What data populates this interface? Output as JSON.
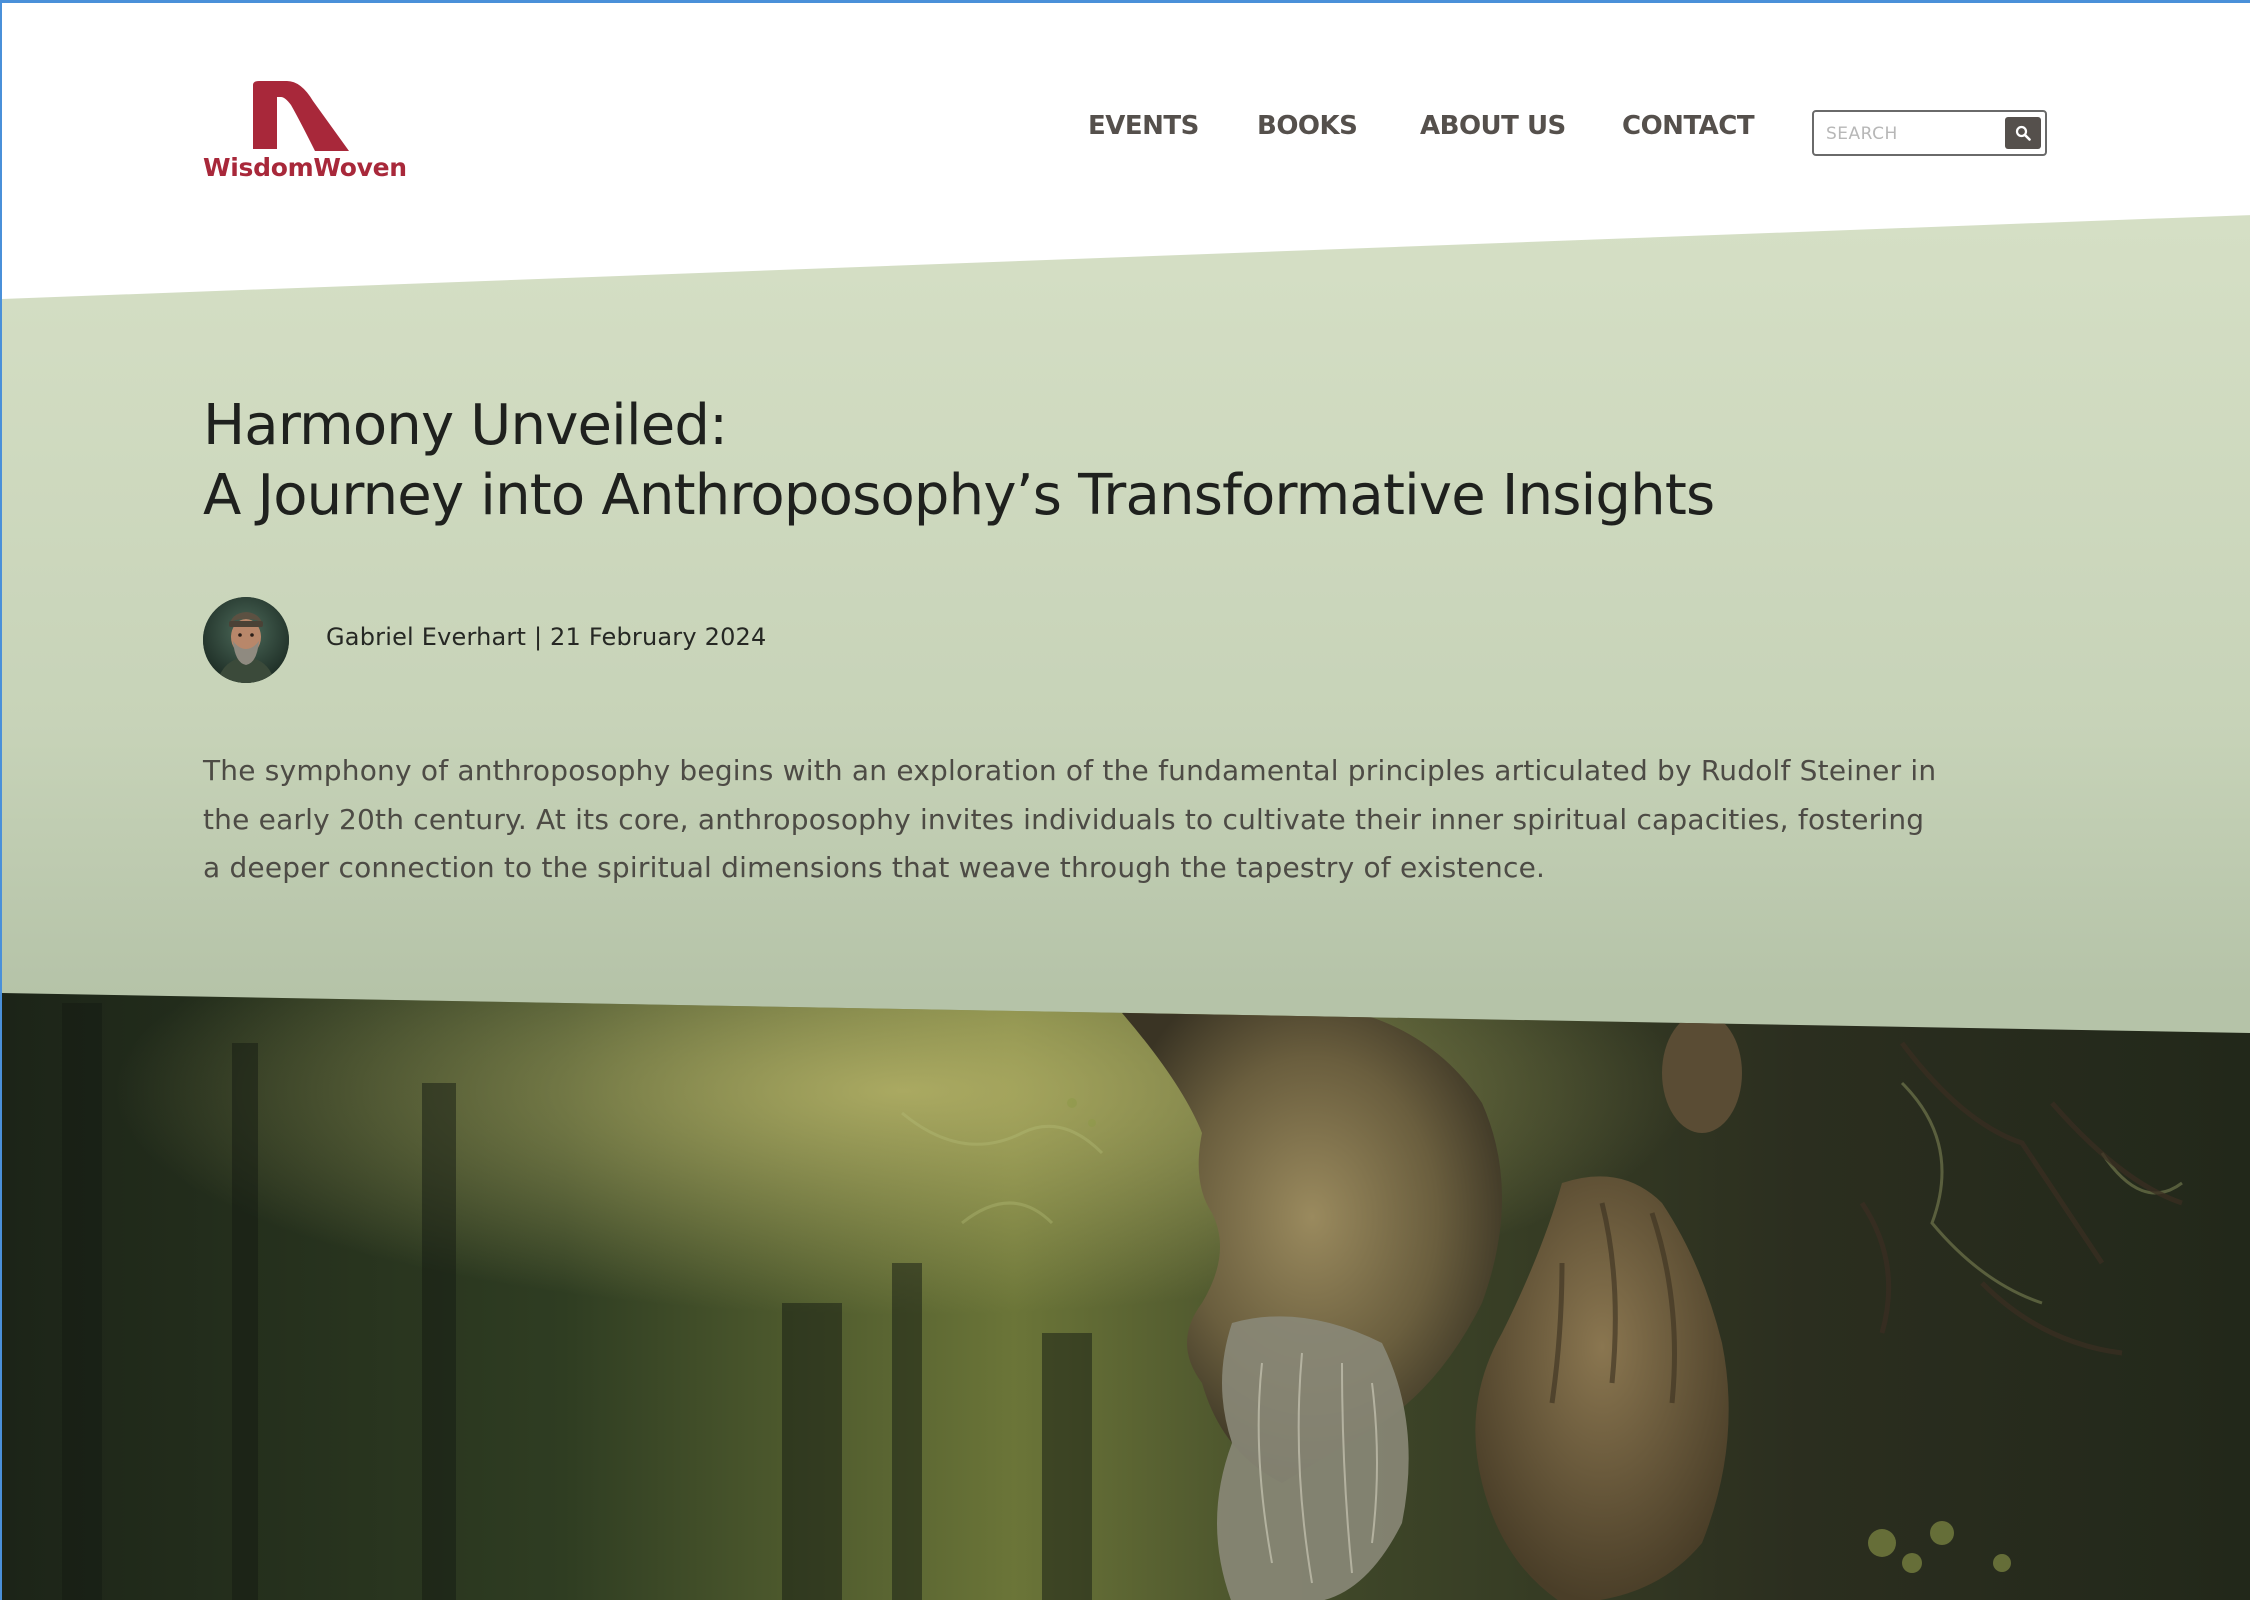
{
  "brand": {
    "name": "WisdomWoven",
    "color": "#a8283a"
  },
  "nav": {
    "items": [
      {
        "label": "EVENTS"
      },
      {
        "label": "BOOKS"
      },
      {
        "label": "ABOUT US"
      },
      {
        "label": "CONTACT"
      }
    ]
  },
  "search": {
    "placeholder": "SEARCH",
    "icon": "search-icon"
  },
  "article": {
    "title_line1": "Harmony Unveiled:",
    "title_line2": "A Journey into Anthroposophy’s Transformative Insights",
    "byline": "Gabriel Everhart | 21 February 2024",
    "intro_line1": "The symphony of anthroposophy begins with an exploration of the fundamental principles articulated by Rudolf Steiner in",
    "intro_line2": "the early 20th century. At its core, anthroposophy invites individuals to cultivate their inner spiritual capacities, fostering",
    "intro_line3": "a deeper connection to the spiritual dimensions that weave through the tapestry of existence."
  },
  "colors": {
    "hero_green": "#d5dfc5",
    "nav_text": "#55504c",
    "title_text": "#1f211e",
    "body_text": "#4d4b45"
  }
}
